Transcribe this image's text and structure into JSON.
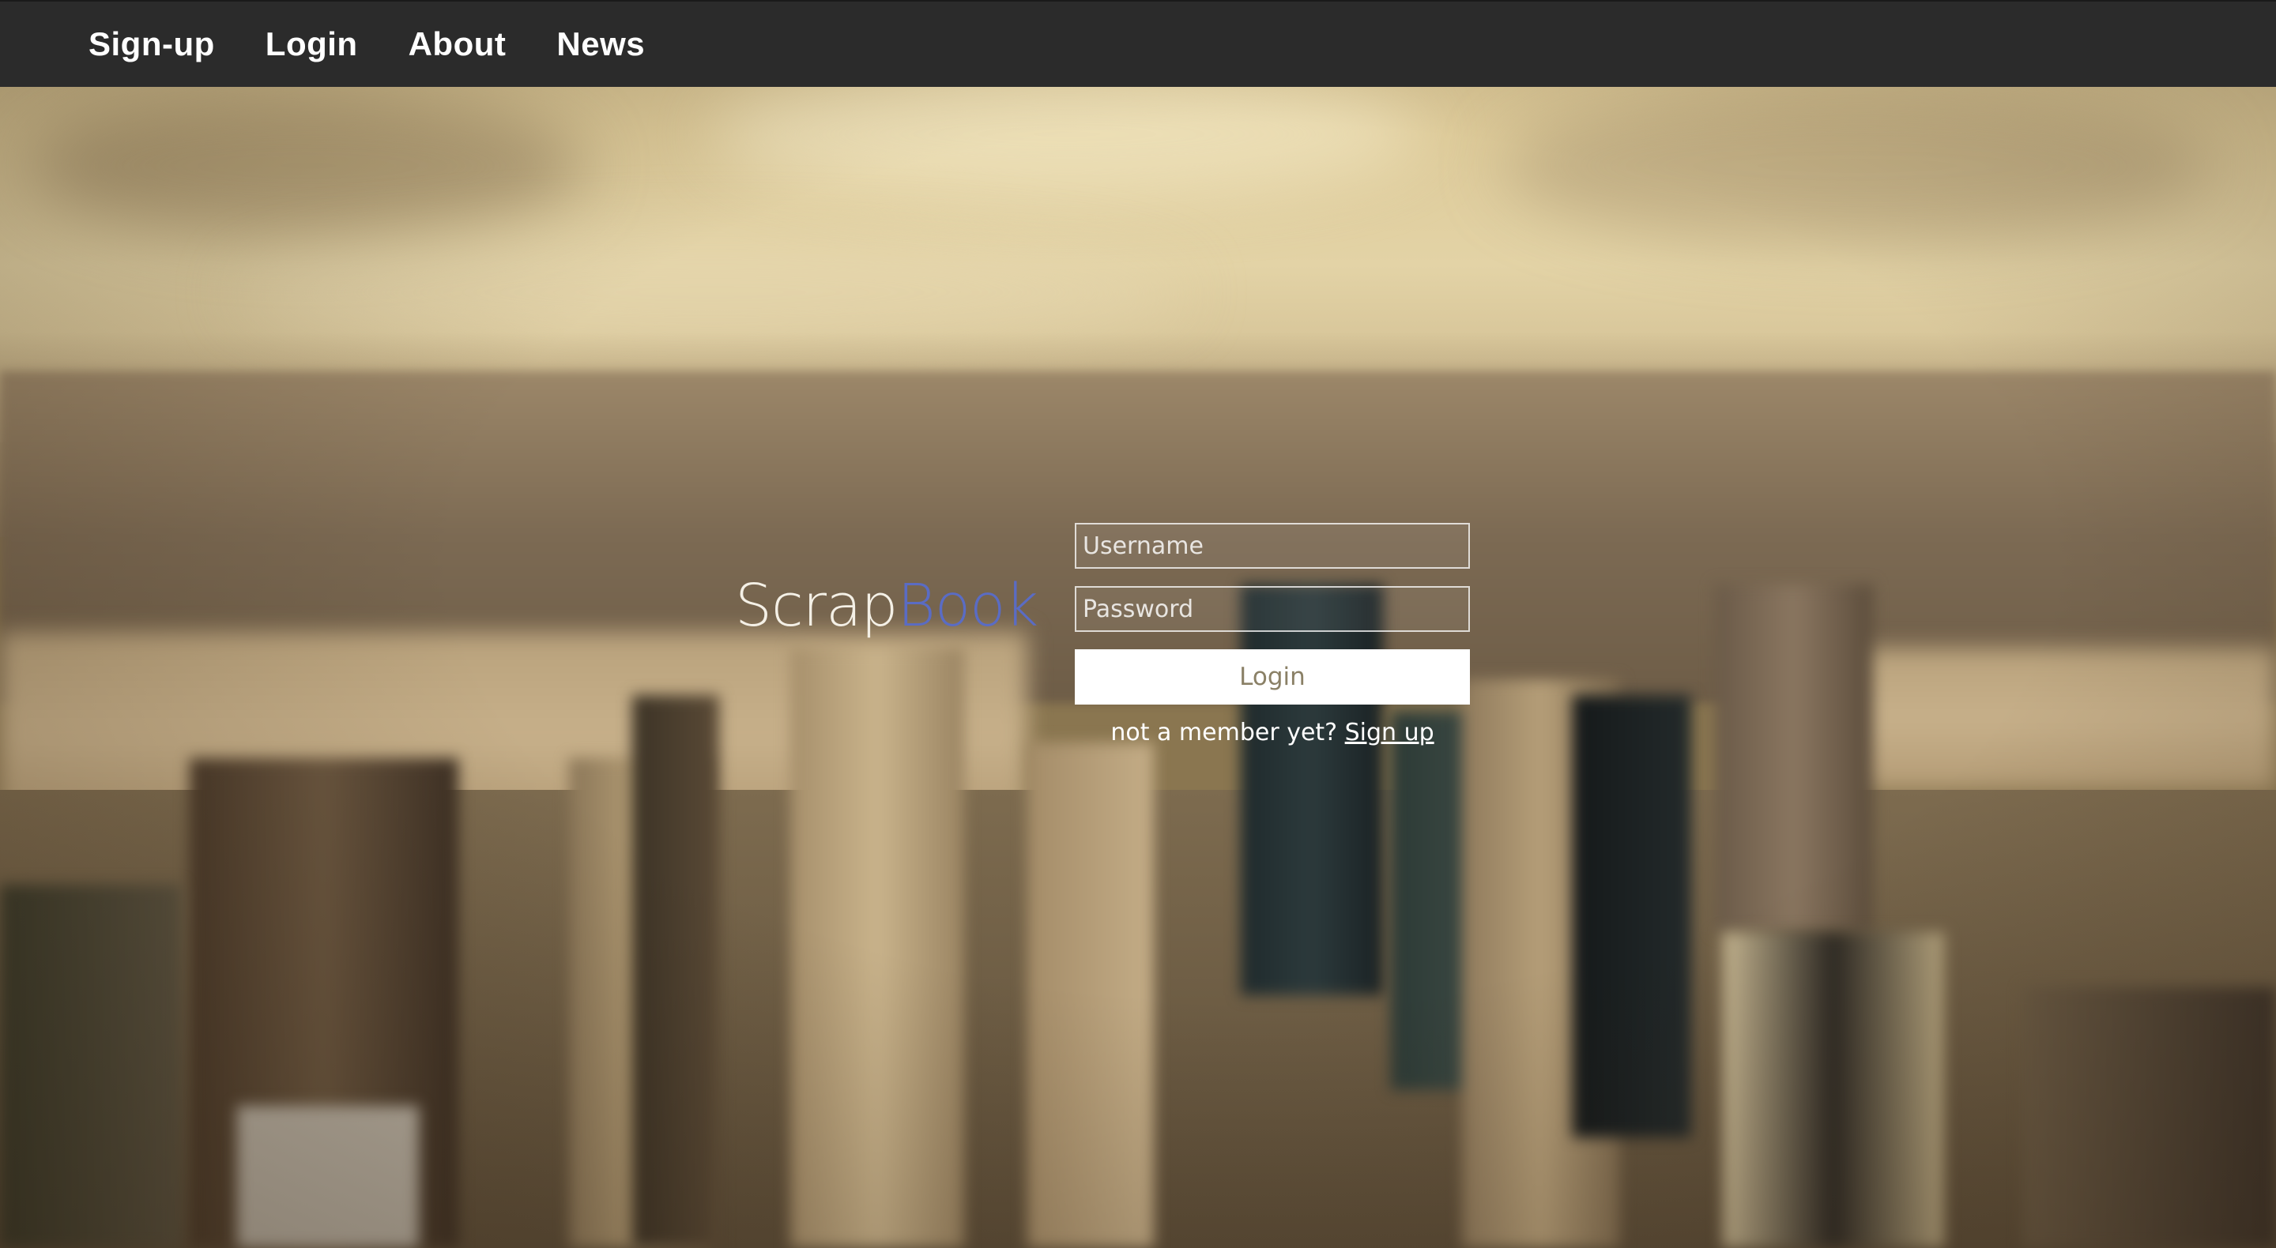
{
  "nav": {
    "items": [
      {
        "label": "Sign-up"
      },
      {
        "label": "Login"
      },
      {
        "label": "About"
      },
      {
        "label": "News"
      }
    ]
  },
  "brand": {
    "part1": "Scrap",
    "part2": "Book"
  },
  "login_form": {
    "username_placeholder": "Username",
    "username_value": "",
    "password_placeholder": "Password",
    "password_value": "",
    "submit_label": "Login",
    "signup_prompt": "not a member yet?",
    "signup_link_label": "Sign up"
  },
  "colors": {
    "navbar_bg": "#2b2b2b",
    "brand_accent": "#5a6cc4",
    "button_text": "#8a8066"
  }
}
